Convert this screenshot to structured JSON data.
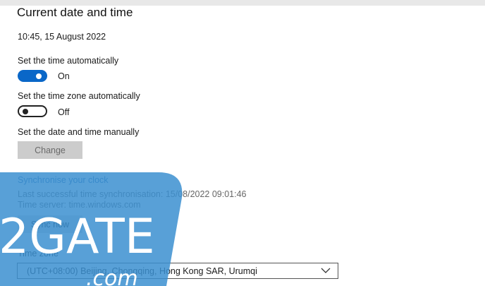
{
  "heading": "Current date and time",
  "datetime": "10:45, 15 August 2022",
  "auto_time": {
    "label": "Set the time automatically",
    "state": "On"
  },
  "auto_zone": {
    "label": "Set the time zone automatically",
    "state": "Off"
  },
  "manual": {
    "label": "Set the date and time manually",
    "button": "Change"
  },
  "sync": {
    "heading": "Synchronise your clock",
    "last": "Last successful time synchronisation: 15/08/2022 09:01:46",
    "server": "Time server: time.windows.com",
    "button": "Sync now"
  },
  "timezone": {
    "label": "Time zone",
    "value": "(UTC+08:00) Beijing, Chongqing, Hong Kong SAR, Urumqi"
  },
  "watermark": {
    "text": "2GATE",
    "sub": ".com"
  },
  "colors": {
    "accent": "#0a67c8",
    "watermark": "#3b8fd0"
  }
}
